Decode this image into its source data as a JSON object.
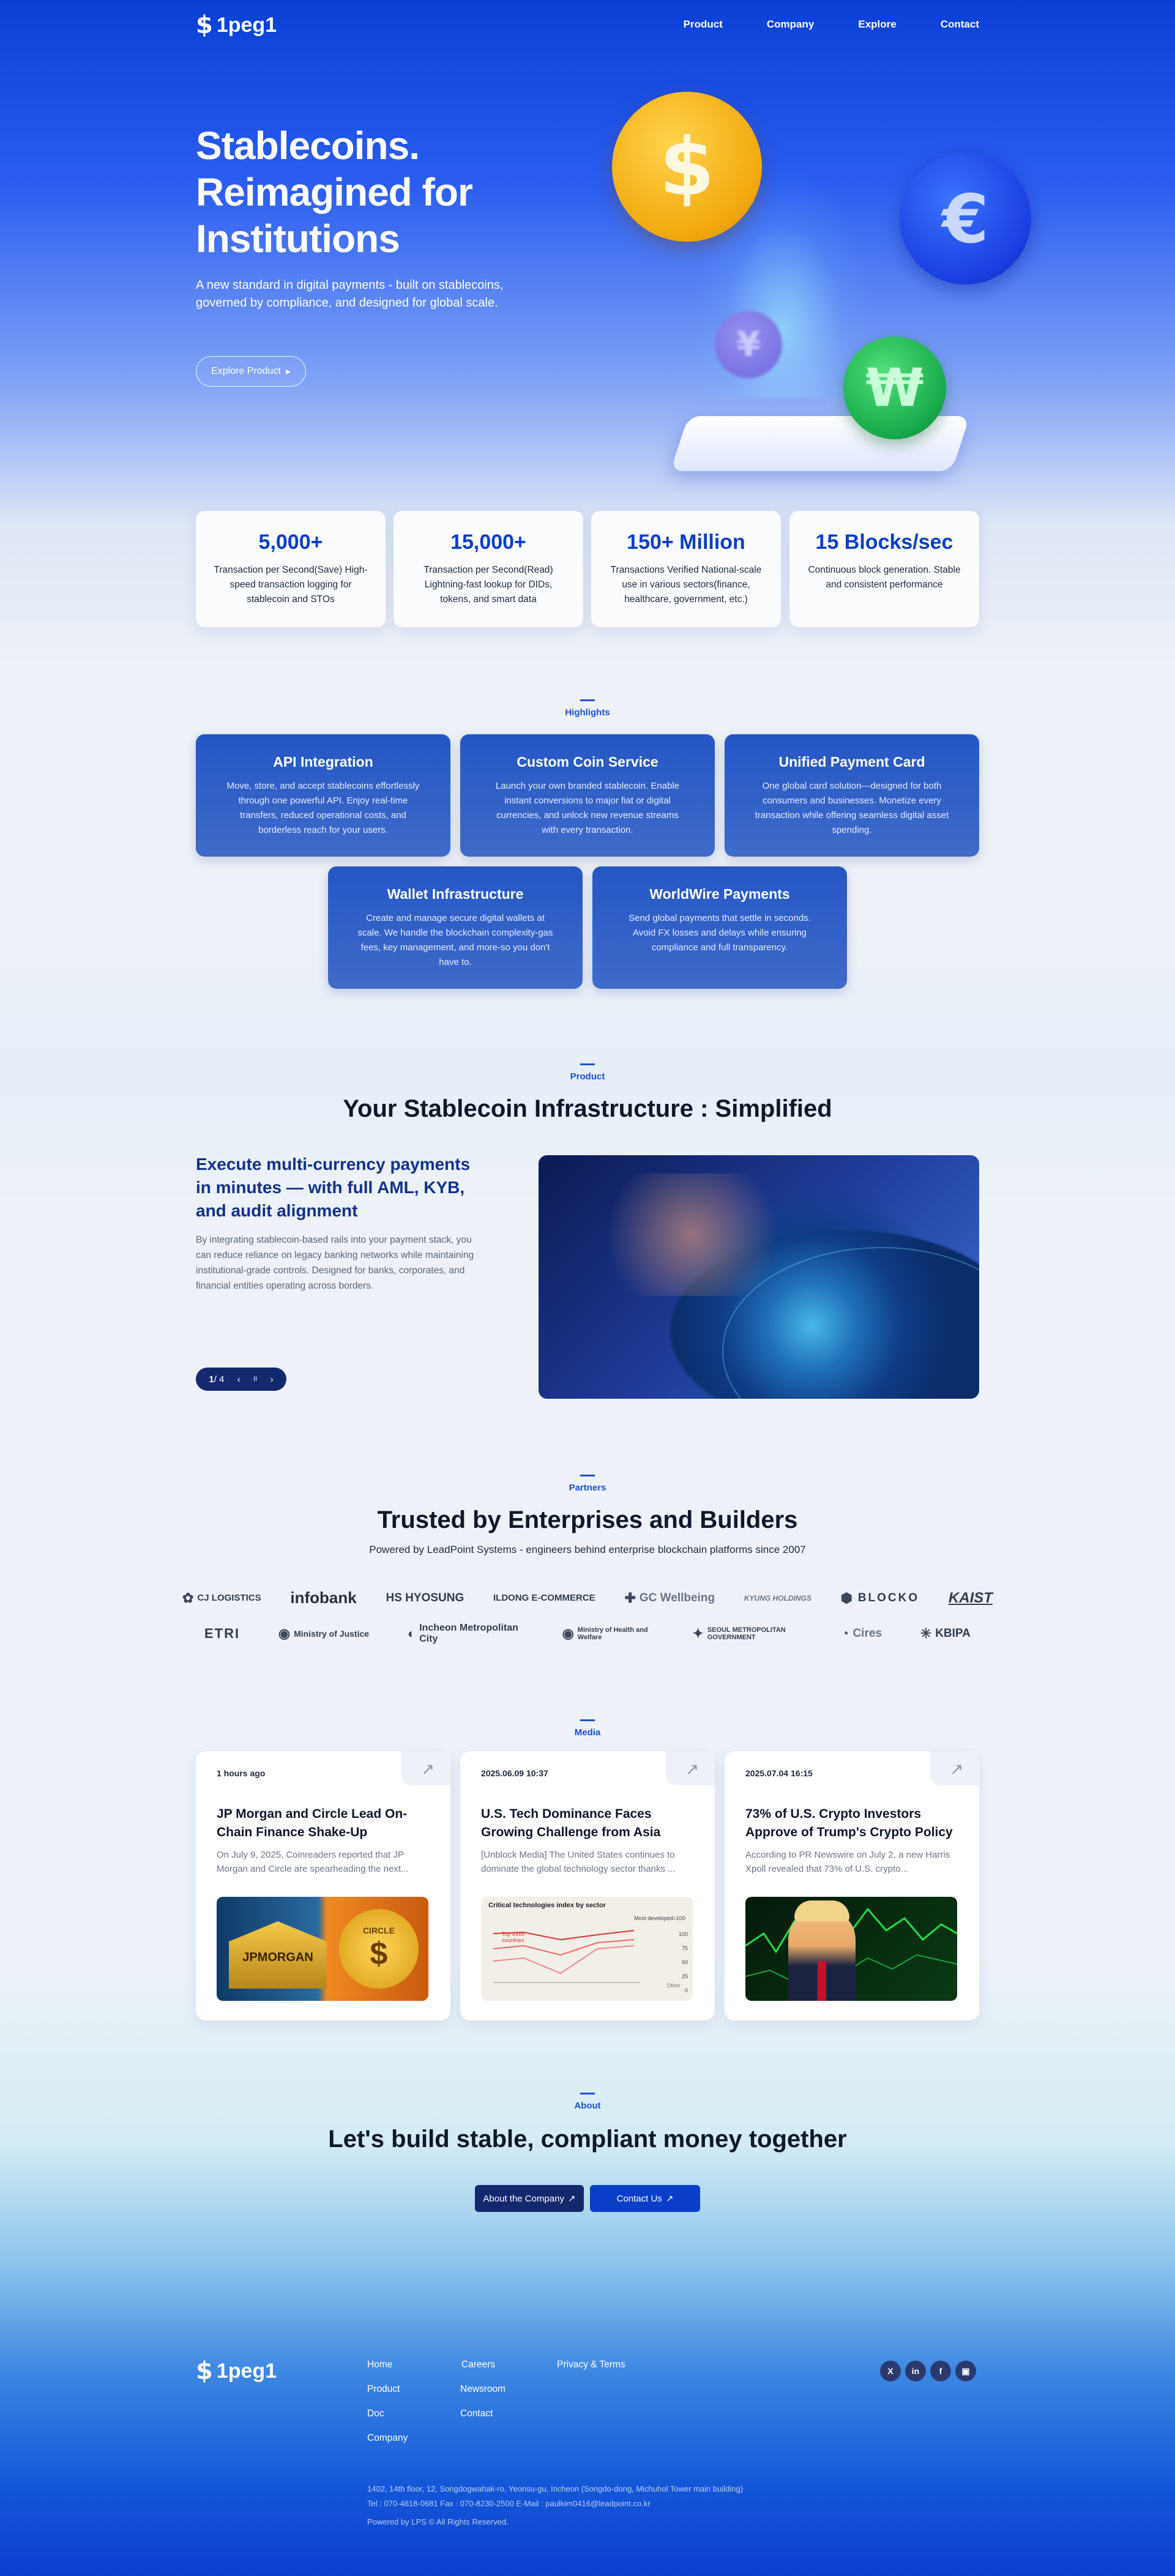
{
  "brand": {
    "name": "1peg1",
    "mark": "$"
  },
  "nav": [
    "Product",
    "Company",
    "Explore",
    "Contact"
  ],
  "hero": {
    "title_line1": "Stablecoins.",
    "title_line2": "Reimagined for",
    "title_line3": "Institutions",
    "subtitle": "A new standard in digital payments - built on stablecoins, governed by compliance, and designed for global scale.",
    "cta": "Explore Product",
    "coins": [
      "$",
      "€",
      "¥",
      "₩"
    ]
  },
  "stats": [
    {
      "value": "5,000+",
      "desc": "Transaction per Second(Save) High-speed transaction logging for stablecoin and STOs"
    },
    {
      "value": "15,000+",
      "desc": "Transaction per Second(Read) Lightning-fast lookup for DIDs, tokens, and smart data"
    },
    {
      "value": "150+ Million",
      "desc": "Transactions Verified National-scale use in various sectors(finance, healthcare, government, etc.)"
    },
    {
      "value": "15 Blocks/sec",
      "desc": "Continuous block generation. Stable and consistent performance"
    }
  ],
  "highlights": {
    "label": "Highlights",
    "cards": [
      {
        "title": "API Integration",
        "desc": "Move, store, and accept stablecoins effortlessly through one powerful API. Enjoy real-time transfers, reduced operational costs, and borderless reach for your users."
      },
      {
        "title": "Custom Coin Service",
        "desc": "Launch your own branded stablecoin. Enable instant conversions to major fiat or digital currencies, and unlock new revenue streams with every transaction."
      },
      {
        "title": "Unified Payment Card",
        "desc": "One global card solution—designed for both consumers and businesses. Monetize every transaction while offering seamless digital asset spending."
      },
      {
        "title": "Wallet Infrastructure",
        "desc": "Create and manage secure digital wallets at scale. We handle the blockchain complexity-gas fees, key management, and more-so you don't have to."
      },
      {
        "title": "WorldWire Payments",
        "desc": "Send global payments that settle in seconds. Avoid FX losses and delays while ensuring compliance and full transparency."
      }
    ]
  },
  "product": {
    "label": "Product",
    "title": "Your Stablecoin Infrastructure : Simplified",
    "heading": "Execute multi-currency payments in minutes — with full AML, KYB, and audit alignment",
    "text": "By integrating stablecoin-based rails into your payment stack, you can reduce reliance on legacy banking networks while maintaining institutional-grade controls. Designed for banks, corporates, and financial entities operating across borders.",
    "pager": {
      "current": "1",
      "total": "/ 4",
      "prev": "‹",
      "pause": "II",
      "next": "›"
    }
  },
  "partners": {
    "label": "Partners",
    "title": "Trusted by Enterprises and Builders",
    "subtitle": "Powered by LeadPoint Systems - engineers behind enterprise blockchain platforms since 2007",
    "row1": [
      "CJ LOGISTICS",
      "infobank",
      "HS HYOSUNG",
      "ILDONG E-COMMERCE",
      "GC Wellbeing",
      "KYUNG HOLDINGS",
      "BLOCKO",
      "KAIST"
    ],
    "row2": [
      "ETRI",
      "Ministry of Justice",
      "Incheon Metropolitan City",
      "Ministry of Health and Welfare",
      "SEOUL METROPOLITAN GOVERNMENT",
      "Cires",
      "KBIPA"
    ]
  },
  "media": {
    "label": "Media",
    "items": [
      {
        "date": "1 hours ago",
        "title": "JP Morgan and Circle Lead On-Chain Finance Shake-Up",
        "desc": "On July 9, 2025, Coinreaders reported that JP Morgan and Circle are spearheading the next...",
        "img_text1": "JPMORGAN",
        "img_text2": "CIRCLE"
      },
      {
        "date": "2025.06.09 10:37",
        "title": "U.S. Tech Dominance Faces Growing Challenge from Asia",
        "desc": "[Unblock Media] The United States continues to dominate the global technology sector thanks ...",
        "img_title": "Critical technologies index by sector",
        "img_note": "Most developed=100",
        "img_legend": "Top three countries",
        "img_other": "Other",
        "img_ticks": [
          "100",
          "75",
          "50",
          "25",
          "0"
        ]
      },
      {
        "date": "2025.07.04 16:15",
        "title": "73% of U.S. Crypto Investors Approve of Trump's Crypto Policy",
        "desc": "According to PR Newswire on July 2, a new Harris Xpoll revealed that 73% of U.S. crypto..."
      }
    ]
  },
  "about": {
    "label": "About",
    "title": "Let's build stable, compliant money together",
    "btn_company": "About the Company",
    "btn_contact": "Contact Us",
    "ext_icon": "↗"
  },
  "footer": {
    "col1": [
      "Home",
      "Product",
      "Doc",
      "Company"
    ],
    "col2": [
      "Careers",
      "Newsroom",
      "Contact"
    ],
    "col3": [
      "Privacy & Terms"
    ],
    "social": [
      "X",
      "in",
      "f",
      "▣"
    ],
    "address": "1402, 14th floor, 12, Songdogwahak-ro, Yeonsu-gu, Incheon (Songdo-dong, Michuhol Tower main building)",
    "contact": "Tel : 070-4618-0681 Fax : 070-8230-2500 E-Mail : paulkim0416@leadpoint.co.kr",
    "copyright": "Powered by LPS © All Rights Reserved."
  },
  "colors": {
    "primary": "#0a3ec9",
    "navy": "#14286e",
    "card": "#2456c4"
  }
}
